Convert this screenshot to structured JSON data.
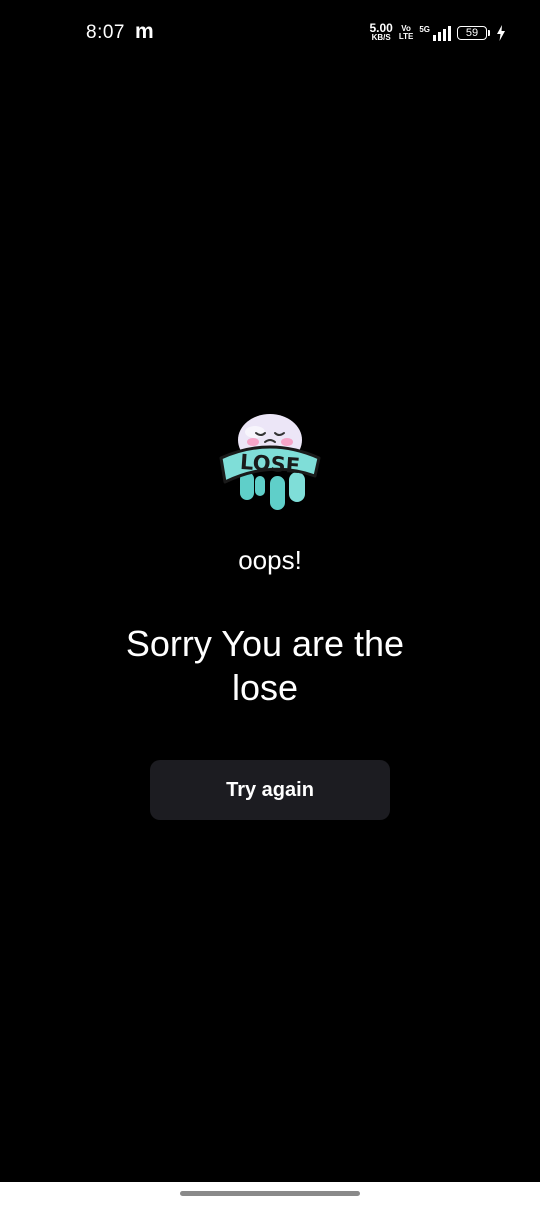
{
  "status_bar": {
    "time": "8:07",
    "app_icon": "m",
    "net_speed_value": "5.00",
    "net_speed_unit": "KB/S",
    "volte_top": "Vo",
    "volte_bottom": "LTE",
    "network_gen": "5G",
    "battery_level": "59"
  },
  "main": {
    "badge_text": "LOSE",
    "oops_text": "oops!",
    "headline": "Sorry You are the lose",
    "try_again_label": "Try again"
  },
  "colors": {
    "background": "#000000",
    "button_bg": "#1c1c21",
    "badge_teal": "#7fded8",
    "mascot_face": "#ece6f7"
  },
  "icons": {
    "app_notification": "m-app-icon",
    "signal": "signal-icon",
    "battery": "battery-icon",
    "charging": "charging-bolt-icon",
    "mascot": "sad-lose-mascot-icon"
  }
}
